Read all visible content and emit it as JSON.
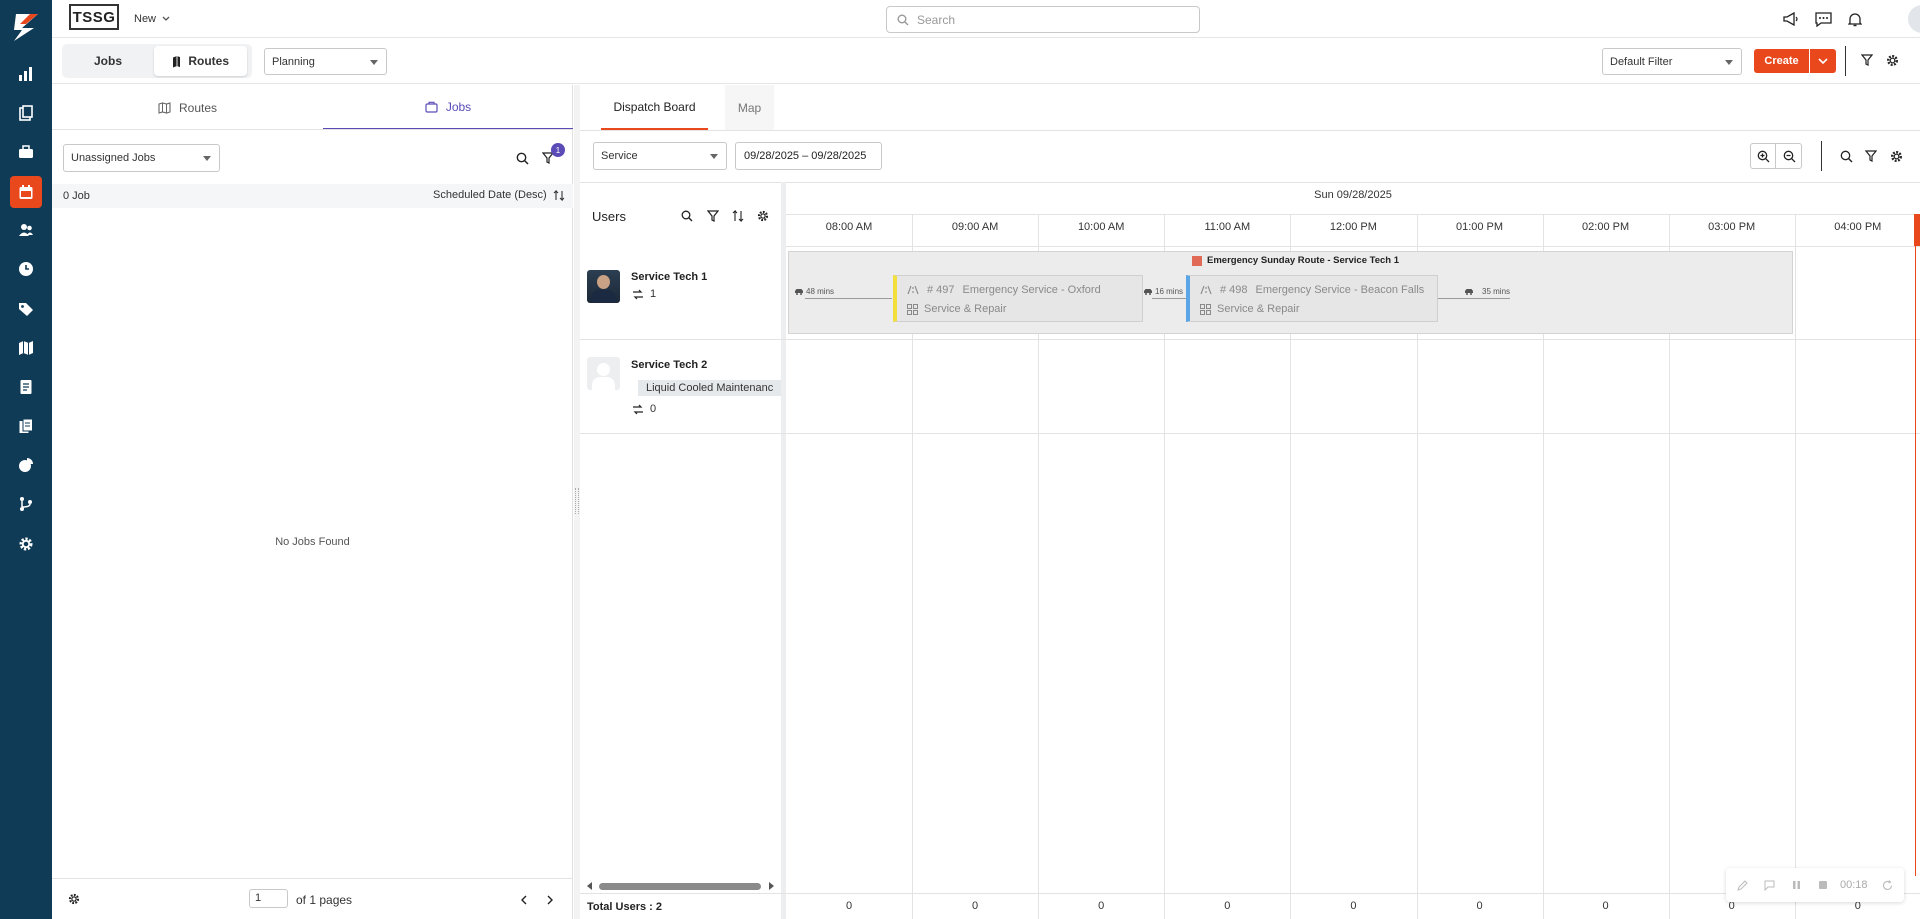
{
  "app": {
    "logo_text": "TSSG",
    "new_label": "New",
    "search_placeholder": "Search"
  },
  "subbar": {
    "jobs_label": "Jobs",
    "routes_label": "Routes",
    "view_select": "Planning",
    "filter_select": "Default Filter",
    "create_label": "Create"
  },
  "left": {
    "tab_routes": "Routes",
    "tab_jobs": "Jobs",
    "job_filter": "Unassigned Jobs",
    "filter_badge": "1",
    "job_count": "0 Job",
    "sort_label": "Scheduled Date (Desc)",
    "empty_text": "No Jobs Found",
    "page_value": "1",
    "page_of": "of 1 pages"
  },
  "right": {
    "tab_dispatch": "Dispatch Board",
    "tab_map": "Map",
    "service_select": "Service",
    "date_range": "09/28/2025 – 09/28/2025",
    "users_header": "Users",
    "date_header": "Sun 09/28/2025",
    "hours": [
      "08:00 AM",
      "09:00 AM",
      "10:00 AM",
      "11:00 AM",
      "12:00 PM",
      "01:00 PM",
      "02:00 PM",
      "03:00 PM",
      "04:00 PM"
    ],
    "footer_counts": [
      "0",
      "0",
      "0",
      "0",
      "0",
      "0",
      "0",
      "0",
      "0"
    ],
    "total_users": "Total Users : 2",
    "users": [
      {
        "name": "Service Tech 1",
        "routes": "1"
      },
      {
        "name": "Service Tech 2",
        "skill": "Liquid Cooled Maintenanc",
        "routes": "0"
      }
    ],
    "route_title": "Emergency Sunday Route - Service Tech 1",
    "travel": [
      "48 mins",
      "16 mins",
      "35 mins"
    ],
    "jobs": [
      {
        "number": "# 497",
        "title": "Emergency Service - Oxford",
        "type": "Service & Repair"
      },
      {
        "number": "# 498",
        "title": "Emergency Service - Beacon Falls",
        "type": "Service & Repair"
      }
    ],
    "timer": "00:18"
  },
  "colors": {
    "sidebar": "#0f3b56",
    "accent": "#e8481c",
    "job_tab_active": "#5a4bb7"
  }
}
